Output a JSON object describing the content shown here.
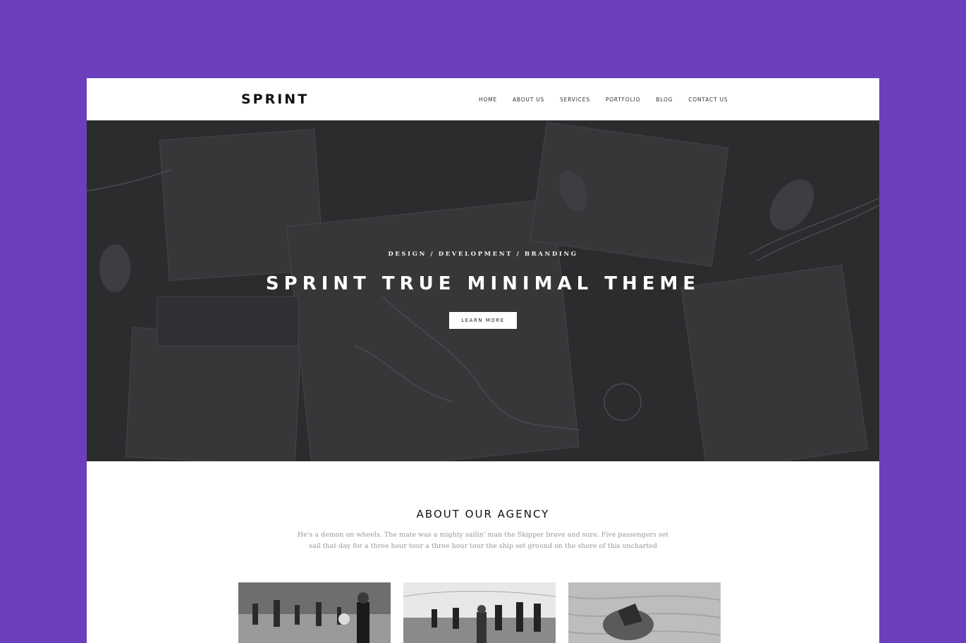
{
  "brand": {
    "logo": "SPRINT"
  },
  "nav": [
    {
      "label": "HOME"
    },
    {
      "label": "ABOUT US"
    },
    {
      "label": "SERVICES"
    },
    {
      "label": "PORTFOLIO"
    },
    {
      "label": "BLOG"
    },
    {
      "label": "CONTACT US"
    }
  ],
  "hero": {
    "subtitle": "DESIGN / DEVELOPMENT / BRANDING",
    "title": "SPRINT TRUE MINIMAL THEME",
    "button_label": "LEARN MORE"
  },
  "about": {
    "title": "ABOUT OUR AGENCY",
    "text": "He's a demon on wheels. The mate was a mighty sailin' man the Skipper brave and sure. Five passengers set sail that day for a three hour tour a three hour tour the ship set ground on the shore of this uncharted"
  },
  "colors": {
    "background": "#6b3fbb",
    "hero_overlay": "#2b2c2e",
    "text": "#111111"
  }
}
